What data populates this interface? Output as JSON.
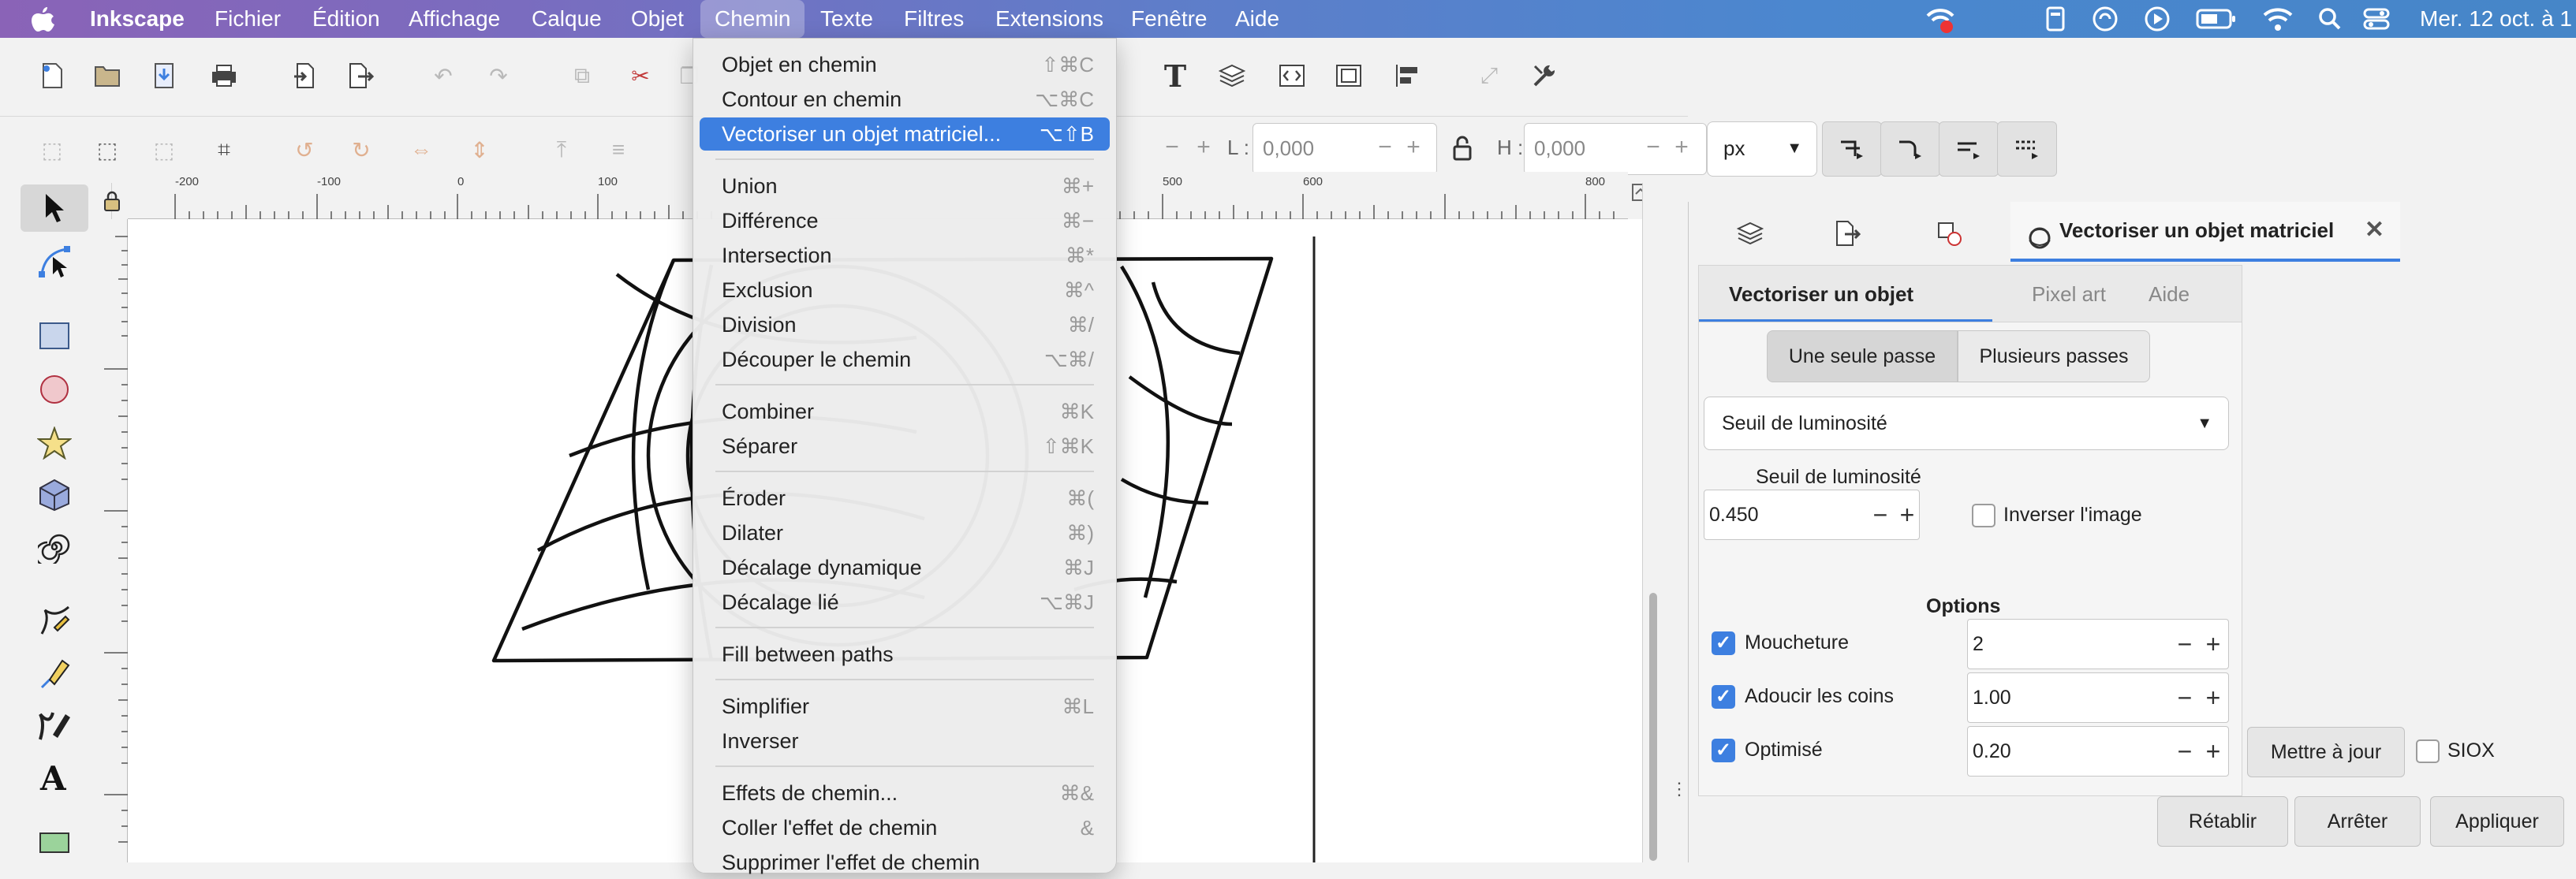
{
  "menubar": {
    "app_name": "Inkscape",
    "items": [
      "Fichier",
      "Édition",
      "Affichage",
      "Calque",
      "Objet",
      "Chemin",
      "Texte",
      "Filtres",
      "Extensions",
      "Fenêtre",
      "Aide"
    ],
    "active_item": "Chemin",
    "clock": "Mer. 12 oct. à 1"
  },
  "toolbar2": {
    "w_label": "L :",
    "w_value": "0,000",
    "h_label": "H :",
    "h_value": "0,000",
    "unit": "px"
  },
  "ruler": {
    "h_ticks": [
      "-200",
      "-100",
      "0",
      "100",
      "500",
      "600",
      "800"
    ]
  },
  "path_menu": {
    "items": [
      {
        "label": "Objet en chemin",
        "shortcut": "⇧⌘C"
      },
      {
        "label": "Contour en chemin",
        "shortcut": "⌥⌘C"
      },
      {
        "label": "Vectoriser un objet matriciel...",
        "shortcut": "⌥⇧B",
        "highlighted": true
      },
      {
        "label": "Union",
        "shortcut": "⌘+"
      },
      {
        "label": "Différence",
        "shortcut": "⌘−"
      },
      {
        "label": "Intersection",
        "shortcut": "⌘*"
      },
      {
        "label": "Exclusion",
        "shortcut": "⌘^"
      },
      {
        "label": "Division",
        "shortcut": "⌘/"
      },
      {
        "label": "Découper le chemin",
        "shortcut": "⌥⌘/"
      },
      {
        "label": "Combiner",
        "shortcut": "⌘K"
      },
      {
        "label": "Séparer",
        "shortcut": "⇧⌘K"
      },
      {
        "label": "Éroder",
        "shortcut": "⌘("
      },
      {
        "label": "Dilater",
        "shortcut": "⌘)"
      },
      {
        "label": "Décalage dynamique",
        "shortcut": "⌘J"
      },
      {
        "label": "Décalage lié",
        "shortcut": "⌥⌘J"
      },
      {
        "label": "Fill between paths",
        "shortcut": ""
      },
      {
        "label": "Simplifier",
        "shortcut": "⌘L"
      },
      {
        "label": "Inverser",
        "shortcut": ""
      },
      {
        "label": "Effets de chemin...",
        "shortcut": "⌘&"
      },
      {
        "label": "Coller l'effet de chemin",
        "shortcut": "&"
      },
      {
        "label": "Supprimer l'effet de chemin",
        "shortcut": ""
      }
    ]
  },
  "trace_dialog": {
    "tab_title": "Vectoriser un objet matriciel",
    "subtabs": [
      "Vectoriser un objet matriciel",
      "Pixel art",
      "Aide"
    ],
    "active_subtab": "Vectoriser un objet matriciel",
    "modes": [
      "Une seule passe",
      "Plusieurs passes"
    ],
    "active_mode": "Une seule passe",
    "method": "Seuil de luminosité",
    "threshold_label": "Seuil de luminosité",
    "threshold_value": "0.450",
    "invert_label": "Inverser l'image",
    "invert_checked": false,
    "options_title": "Options",
    "speckles_label": "Moucheture",
    "speckles_checked": true,
    "speckles_value": "2",
    "smooth_label": "Adoucir les coins",
    "smooth_checked": true,
    "smooth_value": "1.00",
    "optimize_label": "Optimisé",
    "optimize_checked": true,
    "optimize_value": "0.20",
    "update_button": "Mettre à jour",
    "siox_label": "SIOX",
    "siox_checked": false,
    "reset_button": "Rétablir",
    "stop_button": "Arrêter",
    "apply_button": "Appliquer"
  }
}
